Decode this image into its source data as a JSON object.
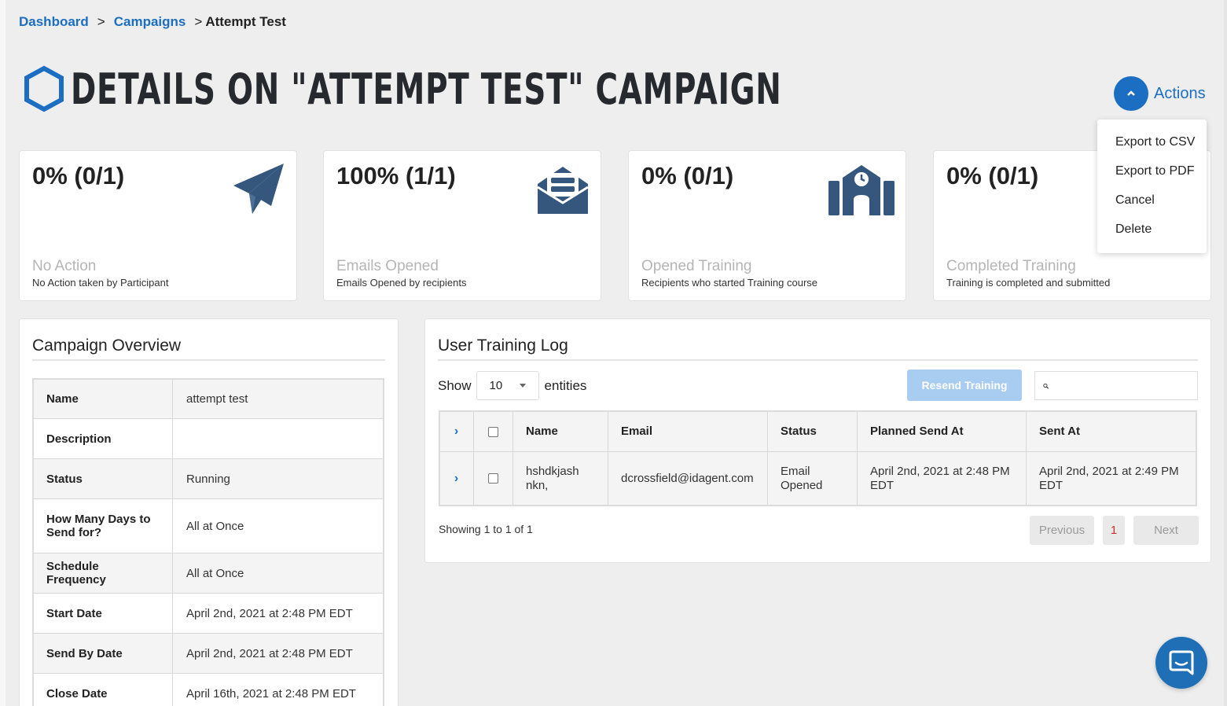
{
  "breadcrumb": {
    "dashboard": "Dashboard",
    "campaigns": "Campaigns",
    "current": "Attempt Test",
    "separator": ">"
  },
  "page": {
    "title": "Details on \"Attempt Test\" Campaign",
    "accent_color": "#1b6ec2"
  },
  "actions": {
    "label": "Actions",
    "menu": [
      "Export to CSV",
      "Export to PDF",
      "Cancel",
      "Delete"
    ]
  },
  "stats": [
    {
      "value": "0% (0/1)",
      "label": "No Action",
      "desc": "No Action taken by Participant",
      "icon": "paper-plane-icon"
    },
    {
      "value": "100% (1/1)",
      "label": "Emails Opened",
      "desc": "Emails Opened by recipients",
      "icon": "open-envelope-icon"
    },
    {
      "value": "0% (0/1)",
      "label": "Opened Training",
      "desc": "Recipients who started Training course",
      "icon": "school-building-icon"
    },
    {
      "value": "0% (0/1)",
      "label": "Completed Training",
      "desc": "Training is completed and submitted",
      "icon": "graduation-icon"
    }
  ],
  "overview": {
    "title": "Campaign Overview",
    "rows": [
      {
        "key": "Name",
        "value": "attempt test"
      },
      {
        "key": "Description",
        "value": ""
      },
      {
        "key": "Status",
        "value": "Running"
      },
      {
        "key": "How Many Days to Send for?",
        "value": "All at Once"
      },
      {
        "key": "Schedule Frequency",
        "value": "All at Once"
      },
      {
        "key": "Start Date",
        "value": "April 2nd, 2021 at 2:48 PM EDT"
      },
      {
        "key": "Send By Date",
        "value": "April 2nd, 2021 at 2:48 PM EDT"
      },
      {
        "key": "Close Date",
        "value": "April 16th, 2021 at 2:48 PM EDT"
      }
    ]
  },
  "training_log": {
    "title": "User Training Log",
    "show_label": "Show",
    "page_length": "10",
    "entities_label": "entities",
    "resend_label": "Resend Training",
    "search_placeholder": "",
    "columns": [
      "Name",
      "Email",
      "Status",
      "Planned Send At",
      "Sent At"
    ],
    "rows": [
      {
        "name": "hshdkjash nkn,",
        "email": "dcrossfield@idagent.com",
        "status": "Email Opened",
        "planned": "April 2nd, 2021 at 2:48 PM EDT",
        "sent": "April 2nd, 2021 at 2:49 PM EDT"
      }
    ],
    "showing": "Showing 1 to 1 of 1",
    "previous": "Previous",
    "current_page": "1",
    "next": "Next"
  },
  "chat": {
    "icon": "chat-bubble-icon"
  }
}
